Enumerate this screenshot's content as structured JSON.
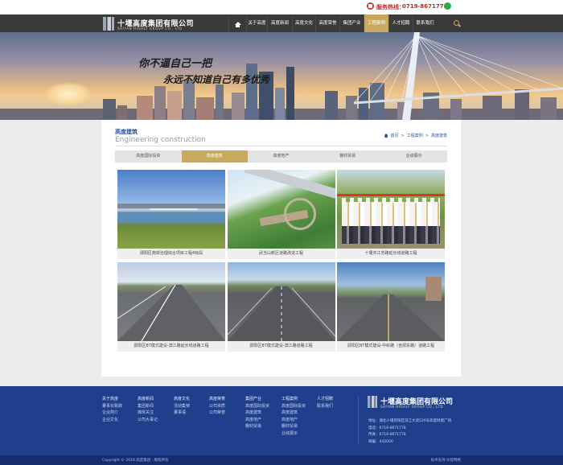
{
  "topbar": {
    "hotline_label": "服务热线：",
    "hotline_number": "0719-8671778"
  },
  "header": {
    "company_cn": "十堰高度集团有限公司",
    "company_en": "SHIYAN HIGHLY GROUP CO., LTD"
  },
  "nav": {
    "items": [
      "关于高度",
      "高度新闻",
      "高度文化",
      "高度荣誉",
      "集团产业",
      "工程案例",
      "人才招聘",
      "联系我们"
    ],
    "active_index": 5
  },
  "banner": {
    "slogan_line1": "你不逼自己一把",
    "slogan_line2": "永远不知道自己有多优秀"
  },
  "section": {
    "title": "高度建筑",
    "subtitle": "Engineering construction",
    "breadcrumb": [
      "首页",
      "工程案例",
      "高度建筑"
    ],
    "breadcrumb_sep": ">"
  },
  "tabs": {
    "items": [
      "高度国际投资",
      "高度建筑",
      "高度地产",
      "棚材贸易",
      "业绩展示"
    ],
    "active_index": 1
  },
  "projects": [
    {
      "caption": "郧阳区南岸治理综合项目工程4标段"
    },
    {
      "caption": "武当山新区道路改造工程"
    },
    {
      "caption": "十堰市江苏路延长线道路工程"
    },
    {
      "caption": "郧阳区BT模式建设-滨江路延长线道路工程"
    },
    {
      "caption": "郧阳区BT模式建设-滨江路道路工程"
    },
    {
      "caption": "郧阳区BT模式建设-中岭路（含郧东路）道路工程"
    }
  ],
  "footer": {
    "columns": [
      {
        "head": "关于高度",
        "items": [
          "董事长致辞",
          "企业简介",
          "企业文化"
        ]
      },
      {
        "head": "高度新闻",
        "items": [
          "集团新闻",
          "媒体关注",
          "公司大事记"
        ]
      },
      {
        "head": "高度文化",
        "items": [
          "活动集锦",
          "董事语"
        ]
      },
      {
        "head": "高度荣誉",
        "items": [
          "公司资质",
          "公司荣誉"
        ]
      },
      {
        "head": "集团产业",
        "items": [
          "高度国际投资",
          "高度建筑",
          "高度地产",
          "棚材贸易"
        ]
      },
      {
        "head": "工程案例",
        "items": [
          "高度国际投资",
          "高度建筑",
          "高度地产",
          "棚材贸易",
          "业绩展示"
        ]
      },
      {
        "head": "人才招聘",
        "items": [
          "联系我们"
        ]
      }
    ],
    "company_cn": "十堰高度集团有限公司",
    "company_en": "SHIYAN HIGHLY GROUP CO., LTD",
    "info": [
      "地址：湖北十堰郧阳区滨江大道520号高度财富广场",
      "电话：0719-8671778",
      "传真：0719-8671778",
      "邮编：442000"
    ],
    "copyright": "Copyright © 2018 高度集团 · 版权所有",
    "support": "技术支持:众智网络"
  },
  "colors": {
    "accent": "#c9a95f",
    "nav_bg": "#3a3a3a",
    "footer_bg": "#1f3f8c",
    "title_blue": "#2b54a0"
  }
}
